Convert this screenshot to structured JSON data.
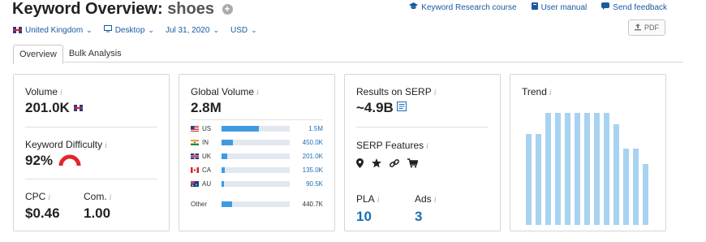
{
  "header": {
    "title_prefix": "Keyword Overview:",
    "keyword": "shoes",
    "add_symbol": "+",
    "links": [
      {
        "label": "Keyword Research course",
        "icon": "graduation-cap-icon"
      },
      {
        "label": "User manual",
        "icon": "book-icon"
      },
      {
        "label": "Send feedback",
        "icon": "chat-bubble-icon"
      }
    ],
    "pdf_label": "PDF"
  },
  "filters": {
    "country": "United Kingdom",
    "device": "Desktop",
    "date": "Jul 31, 2020",
    "currency": "USD"
  },
  "tabs": [
    {
      "label": "Overview",
      "active": true
    },
    {
      "label": "Bulk Analysis",
      "active": false
    }
  ],
  "metrics": {
    "volume": {
      "label": "Volume",
      "value": "201.0K"
    },
    "keyword_difficulty": {
      "label": "Keyword Difficulty",
      "value": "92%",
      "level": 0.92,
      "color": "#e0262b"
    },
    "cpc": {
      "label": "CPC",
      "value": "$0.46"
    },
    "competition": {
      "label": "Com.",
      "value": "1.00"
    },
    "info_symbol": "i"
  },
  "global_volume": {
    "label": "Global Volume",
    "value": "2.8M",
    "rows": [
      {
        "code": "US",
        "value": "1.5M",
        "share": 0.55,
        "flag": "us"
      },
      {
        "code": "IN",
        "value": "450.0K",
        "share": 0.17,
        "flag": "in"
      },
      {
        "code": "UK",
        "value": "201.0K",
        "share": 0.08,
        "flag": "uk"
      },
      {
        "code": "CA",
        "value": "135.0K",
        "share": 0.05,
        "flag": "ca"
      },
      {
        "code": "AU",
        "value": "90.5K",
        "share": 0.04,
        "flag": "au"
      }
    ],
    "other": {
      "label": "Other",
      "value": "440.7K",
      "share": 0.16
    }
  },
  "serp": {
    "results_label": "Results on SERP",
    "results_value": "~4.9B",
    "features_label": "SERP Features",
    "features": [
      "map-pin-icon",
      "star-icon",
      "link-icon",
      "cart-icon"
    ],
    "pla_label": "PLA",
    "pla_value": "10",
    "ads_label": "Ads",
    "ads_value": "3"
  },
  "trend": {
    "label": "Trend",
    "values": [
      0.81,
      0.81,
      1.0,
      1.0,
      1.0,
      1.0,
      1.0,
      1.0,
      1.0,
      0.9,
      0.68,
      0.68,
      0.54
    ],
    "bar_color": "#a7d3f1"
  }
}
